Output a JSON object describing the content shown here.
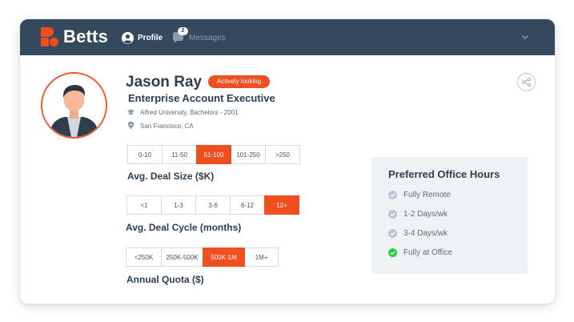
{
  "app": {
    "brand": "Betts"
  },
  "nav": {
    "profile_label": "Profile",
    "messages_label": "Messages",
    "messages_count": "2"
  },
  "profile": {
    "name": "Jason Ray",
    "status": "Actively looking",
    "title": "Enterprise Account Executive",
    "education": "Alfred University, Bachelors - 2001",
    "location": "San Francisco, CA"
  },
  "deal_size": {
    "label": "Avg. Deal Size ($K)",
    "options": [
      "0-10",
      "11-50",
      "51-100",
      "101-250",
      ">250"
    ],
    "selected": "51-100"
  },
  "deal_cycle": {
    "label": "Avg. Deal Cycle (months)",
    "options": [
      "<1",
      "1-3",
      "3-6",
      "6-12",
      "12+"
    ],
    "selected": "12+"
  },
  "quota": {
    "label": "Annual Quota ($)",
    "options": [
      "<250K",
      "250K-500K",
      "500K-1M",
      "1M+"
    ],
    "selected": "500K-1M"
  },
  "office_hours": {
    "title": "Preferred Office Hours",
    "items": [
      {
        "label": "Fully Remote",
        "selected": false
      },
      {
        "label": "1-2 Days/wk",
        "selected": false
      },
      {
        "label": "3-4 Days/wk",
        "selected": false
      },
      {
        "label": "Fully at Office",
        "selected": true
      }
    ]
  },
  "colors": {
    "header": "#34495e",
    "accent": "#ef4e1f",
    "text_dark": "#2c3e50",
    "check_selected": "#2ecc40",
    "check_unselected": "#b9c7d4"
  },
  "icons": {
    "logo": "betts-logo-icon",
    "profile": "user-icon",
    "messages": "chat-bubble-icon",
    "dropdown": "chevron-down-icon",
    "share": "share-icon",
    "education": "graduation-cap-icon",
    "location": "map-pin-icon",
    "check": "check-circle-icon"
  }
}
